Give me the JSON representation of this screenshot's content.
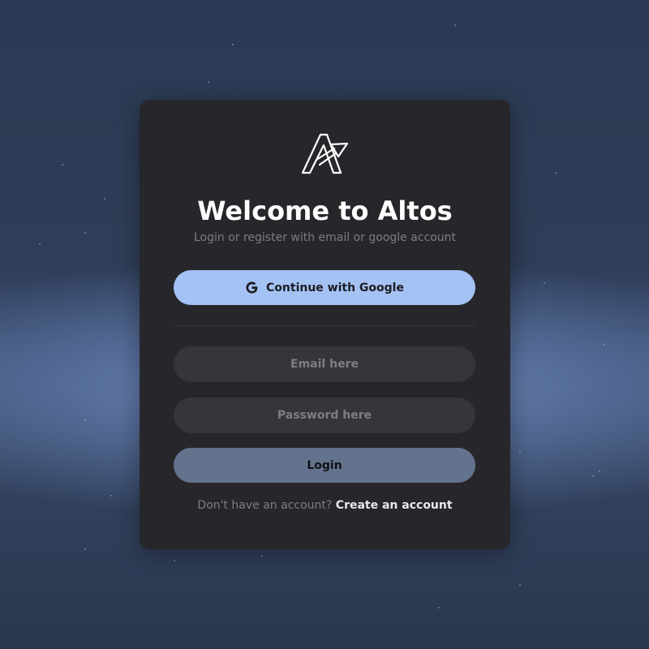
{
  "brand": {
    "logo_icon": "altos-logo-icon",
    "accent": "#a4c2f4"
  },
  "card": {
    "title": "Welcome to Altos",
    "subtitle": "Login or register with email or google account"
  },
  "google_button": {
    "icon": "google-g-icon",
    "label": "Continue with Google"
  },
  "form": {
    "email_placeholder": "Email here",
    "email_value": "",
    "password_placeholder": "Password here",
    "password_value": "",
    "login_label": "Login"
  },
  "footer": {
    "prompt": "Don't have an account?",
    "create_link": "Create an account"
  }
}
